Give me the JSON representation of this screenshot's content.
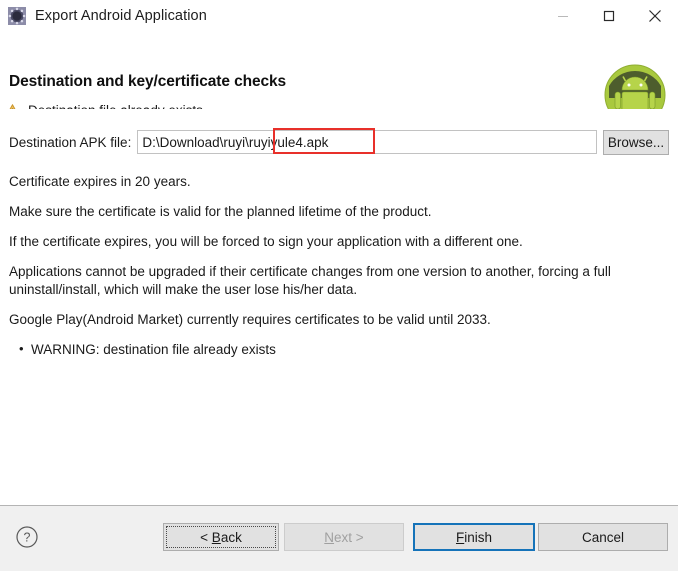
{
  "window": {
    "title": "Export Android Application",
    "icon": "eclipse-wizard-icon",
    "controls": {
      "minimize": "minimize-icon",
      "maximize": "maximize-icon",
      "close": "close-icon"
    }
  },
  "header": {
    "title": "Destination and key/certificate checks",
    "message": "Destination file already exists.",
    "message_icon": "warning-triangle-icon",
    "brand_icon": "android-robot-icon"
  },
  "form": {
    "apk_label": "Destination APK file:",
    "apk_value": "D:\\Download\\ruyi\\ruyiyule4.apk",
    "apk_placeholder": "",
    "browse_label": "Browse..."
  },
  "annotation": {
    "color": "#e8302a",
    "target_text": "ruyiyule4.apk"
  },
  "content": {
    "paragraphs": [
      "Certificate expires in 20 years.",
      "Make sure the certificate is valid for the planned lifetime of the product.",
      "If the certificate expires, you will be forced to sign your application with a different one.",
      "Applications cannot be upgraded if their certificate changes from one version to another, forcing a full uninstall/install, which will make the user lose his/her data.",
      "Google Play(Android Market) currently requires certificates to be valid until 2033."
    ],
    "bullets": [
      "WARNING: destination file already exists"
    ]
  },
  "footer": {
    "help_icon": "help-question-icon",
    "buttons": {
      "back": {
        "label": "< Back",
        "state": "focused"
      },
      "next": {
        "label": "Next >",
        "state": "disabled"
      },
      "finish": {
        "label": "Finish",
        "state": "default"
      },
      "cancel": {
        "label": "Cancel",
        "state": "normal"
      }
    }
  },
  "colors": {
    "accent": "#1573b9",
    "warning": "#e8a33d",
    "annotation": "#e8302a",
    "android_green": "#a4c639",
    "footer_bg": "#f0f0f0"
  }
}
